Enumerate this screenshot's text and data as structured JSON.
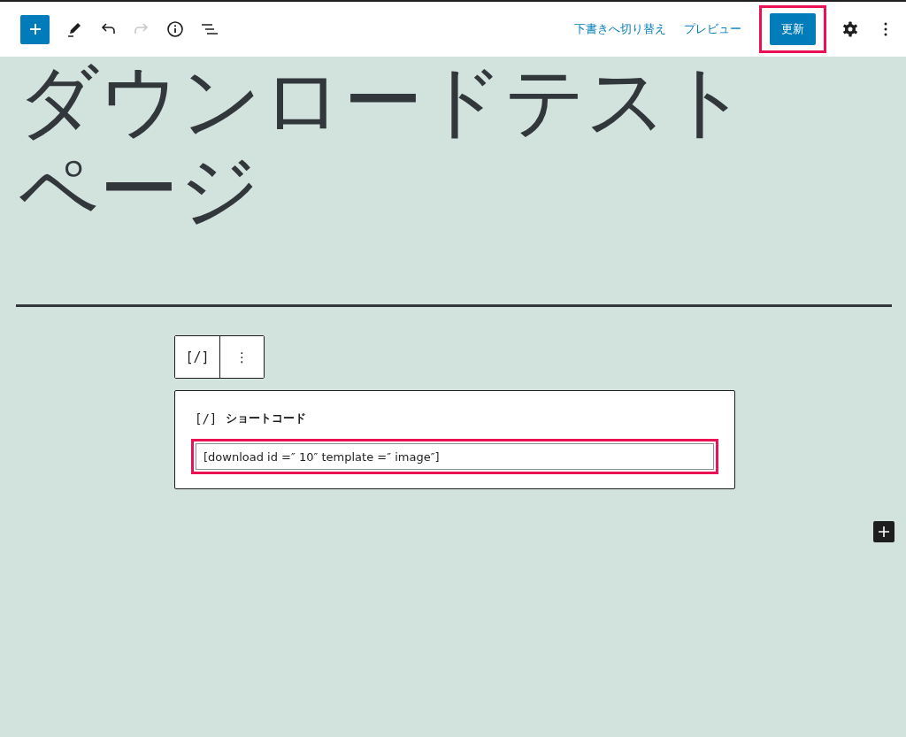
{
  "history": {
    "undo_disabled": false,
    "redo_disabled": true
  },
  "actions": {
    "switch_to_draft": "下書きへ切り替え",
    "preview": "プレビュー",
    "update": "更新"
  },
  "title": "ダウンロードテストページ",
  "block_toolbar": {
    "block_icon": "[/]",
    "more": "⋮"
  },
  "shortcode_block": {
    "icon": "[/]",
    "label": "ショートコード",
    "value": "[download id =″ 10″ template =″ image″]"
  }
}
